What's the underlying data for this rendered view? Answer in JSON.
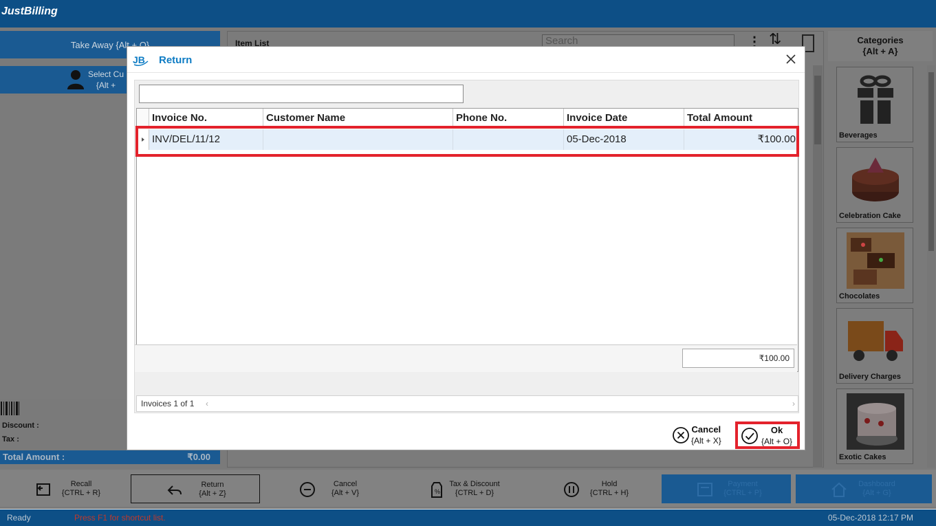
{
  "app": {
    "logo_text": "JustBilling",
    "order_type": "Take Away {Alt + O}",
    "select_customer_line1": "Select Cu",
    "select_customer_line2": "{Alt +",
    "item_list_title": "Item List",
    "search_placeholder": "Search",
    "categories_line1": "Categories",
    "categories_line2": "{Alt + A}",
    "discount_label": "Discount :",
    "tax_label": "Tax :",
    "total_label": "Total Amount :",
    "total_value": "₹0.00"
  },
  "categories": [
    {
      "name": "Beverages",
      "icon": "gift-icon"
    },
    {
      "name": "Celebration Cake",
      "icon": "cake-image"
    },
    {
      "name": "Chocolates",
      "icon": "chocolate-image"
    },
    {
      "name": "Delivery Charges",
      "icon": "truck-icon"
    },
    {
      "name": "Exotic Cakes",
      "icon": "cake-image"
    }
  ],
  "toolbar": {
    "recall": {
      "label": "Recall",
      "shortcut": "{CTRL + R}"
    },
    "return": {
      "label": "Return",
      "shortcut": "{Alt + Z}"
    },
    "cancel": {
      "label": "Cancel",
      "shortcut": "{Alt + V}"
    },
    "tax_discount": {
      "label": "Tax & Discount",
      "shortcut": "{CTRL + D}"
    },
    "hold": {
      "label": "Hold",
      "shortcut": "{CTRL + H}"
    },
    "payment": {
      "label": "Payment",
      "shortcut": "{CTRL + P}"
    },
    "dashboard": {
      "label": "Dashboard",
      "shortcut": "{Alt + G}"
    }
  },
  "status": {
    "ready": "Ready",
    "hint": "Press F1 for shortcut list.",
    "datetime": "05-Dec-2018 12:17 PM"
  },
  "modal": {
    "title": "Return",
    "filter_value": "",
    "columns": [
      "Invoice No.",
      "Customer Name",
      "Phone No.",
      "Invoice Date",
      "Total Amount"
    ],
    "rows": [
      {
        "invoice_no": "INV/DEL/11/12",
        "customer_name": "",
        "phone_no": "",
        "invoice_date": "05-Dec-2018",
        "total_amount": "₹100.00"
      }
    ],
    "summary_total": "₹100.00",
    "pager_text": "Invoices 1 of 1",
    "cancel_label": "Cancel",
    "cancel_shortcut": "{Alt + X}",
    "ok_label": "Ok",
    "ok_shortcut": "{Alt + O}"
  },
  "colors": {
    "brand_blue": "#0d4f86",
    "title_blue": "#0e7cc4",
    "highlight_red": "#e3222c",
    "selected_row": "#e4effa"
  }
}
